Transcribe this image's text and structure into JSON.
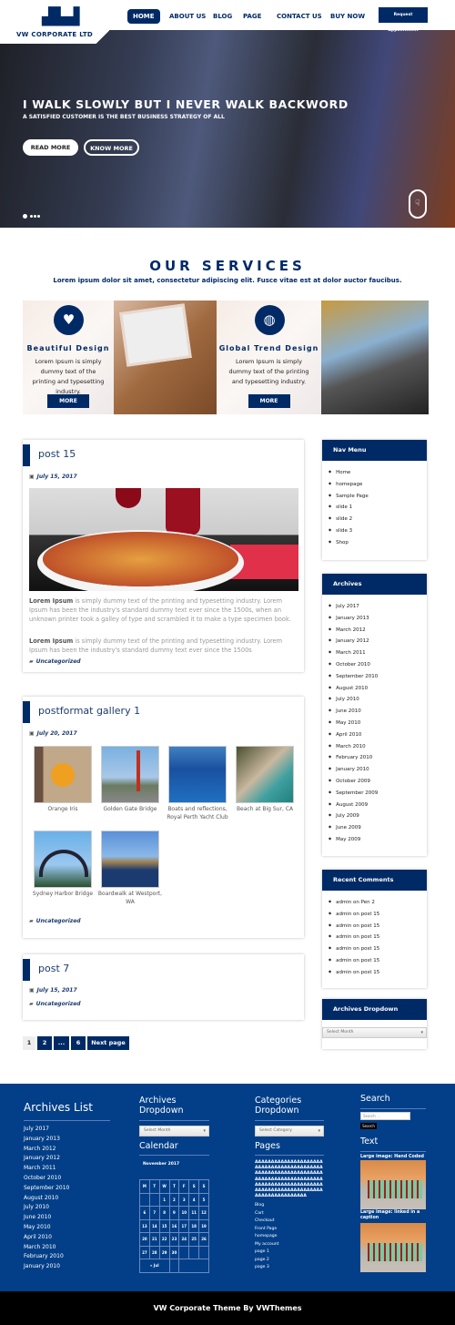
{
  "header": {
    "logo_text": "VW CORPORATE LTD",
    "nav": [
      "HOME",
      "ABOUT US",
      "BLOG",
      "PAGE",
      "CONTACT US",
      "BUY NOW"
    ],
    "active": "HOME",
    "cta": "Request Appointment"
  },
  "hero": {
    "title": "I WALK SLOWLY BUT I NEVER WALK BACKWORD",
    "subtitle": "A SATISFIED CUSTOMER IS THE BEST BUSINESS STRATEGY OF ALL",
    "read_more": "READ MORE",
    "know_more": "KNOW MORE",
    "slides": 4,
    "active_slide": 1
  },
  "services": {
    "title": "OUR SERVICES",
    "subtitle": "Lorem ipsum dolor sit amet, consectetur adipiscing elit. Fusce vitae est at dolor auctor faucibus.",
    "items": [
      {
        "icon": "heart-icon",
        "title": "Beautiful Design",
        "text": "Lorem Ipsum is simply dummy text of the printing and typesetting industry.",
        "button": "MORE"
      },
      {
        "icon": "globe-icon",
        "title": "Global Trend Design",
        "text": "Lorem Ipsum is simply dummy text of the printing and typesetting industry.",
        "button": "MORE"
      }
    ]
  },
  "posts": [
    {
      "title": "post 15",
      "date": "July 15, 2017",
      "p1_bold": "Lorem Ipsum",
      "p1": " is simply dummy text of the printing and typesetting industry. Lorem Ipsum has been the industry's standard dummy text ever since the 1500s, when an unknown printer took a galley of type and scrambled it to make a type specimen book.",
      "p2_bold": "Lorem Ipsum",
      "p2": " is simply dummy text of the printing and typesetting industry. Lorem Ipsum has been the industry's standard dummy text ever since the 1500s",
      "category": "Uncategorized"
    },
    {
      "title": "postformat gallery 1",
      "date": "July 20, 2017",
      "gallery": [
        "Orange Iris",
        "Golden Gate Bridge",
        "Boats and reflections, Royal Perth Yacht Club",
        "Beach at Big Sur, CA",
        "Sydney Harbor Bridge",
        "Boardwalk at Westport, WA"
      ],
      "category": "Uncategorized"
    },
    {
      "title": "post 7",
      "date": "July 15, 2017",
      "category": "Uncategorized"
    }
  ],
  "pagination": {
    "pages": [
      "1",
      "2",
      "...",
      "6"
    ],
    "current": "1",
    "next": "Next page"
  },
  "sidebar": {
    "nav_menu": {
      "title": "Nav Menu",
      "items": [
        "Home",
        "homepage",
        "Sample Page",
        "slide 1",
        "slide 2",
        "slide 3",
        "Shop"
      ]
    },
    "archives": {
      "title": "Archives",
      "items": [
        "July 2017",
        "January 2013",
        "March 2012",
        "January 2012",
        "March 2011",
        "October 2010",
        "September 2010",
        "August 2010",
        "July 2010",
        "June 2010",
        "May 2010",
        "April 2010",
        "March 2010",
        "February 2010",
        "January 2010",
        "October 2009",
        "September 2009",
        "August 2009",
        "July 2009",
        "June 2009",
        "May 2009"
      ]
    },
    "recent_comments": {
      "title": "Recent Comments",
      "items": [
        "admin on Pen 2",
        "admin on post 15",
        "admin on post 15",
        "admin on post 15",
        "admin on post 15",
        "admin on post 15",
        "admin on post 15"
      ]
    },
    "archives_dropdown": {
      "title": "Archives Dropdown",
      "placeholder": "Select Month"
    }
  },
  "footer": {
    "archives_list": {
      "title": "Archives List",
      "items": [
        "July 2017",
        "January 2013",
        "March 2012",
        "January 2012",
        "March 2011",
        "October 2010",
        "September 2010",
        "August 2010",
        "July 2010",
        "June 2010",
        "May 2010",
        "April 2010",
        "March 2010",
        "February 2010",
        "January 2010"
      ]
    },
    "archives_dropdown": {
      "title": "Archives Dropdown",
      "placeholder": "Select Month"
    },
    "calendar": {
      "title": "Calendar",
      "month": "November 2017",
      "days": [
        "M",
        "T",
        "W",
        "T",
        "F",
        "S",
        "S"
      ],
      "weeks": [
        [
          "",
          "",
          "1",
          "2",
          "3",
          "4",
          "5"
        ],
        [
          "6",
          "7",
          "8",
          "9",
          "10",
          "11",
          "12"
        ],
        [
          "13",
          "14",
          "15",
          "16",
          "17",
          "18",
          "19"
        ],
        [
          "20",
          "21",
          "22",
          "23",
          "24",
          "25",
          "26"
        ],
        [
          "27",
          "28",
          "29",
          "30",
          "",
          "",
          ""
        ]
      ],
      "prev": "« Jul"
    },
    "categories_dropdown": {
      "title": "Categories Dropdown",
      "placeholder": "Select Category"
    },
    "pages": {
      "title": "Pages",
      "long": "AAAAAAAAAAAAAAAAAAAAAAAAAAAAAAAAAAAAAAAAAAAAAAAAAAAAAAAAAAAAAAAAAAAAAAAAAAAAAAAAAAAAAAAAAAAAAAAAAAAAAAAAAAAAAAAAAAAAAAAAAAAAAAAAAAAAAAAAAAAAAA",
      "items": [
        "Blog",
        "Cart",
        "Checkout",
        "Front Page",
        "homepage",
        "My account",
        "page 1",
        "page 2",
        "page 3"
      ]
    },
    "search": {
      "title": "Search",
      "placeholder": "Search ...",
      "button": "Search"
    },
    "text": {
      "title": "Text",
      "caption1": "Large image: Hand Coded",
      "caption2": "Large image: linked in a caption"
    },
    "credit": "VW Corporate Theme By VWThemes"
  },
  "colors": {
    "primary": "#002a66",
    "footer": "#023f88",
    "bottom": "#000000"
  }
}
